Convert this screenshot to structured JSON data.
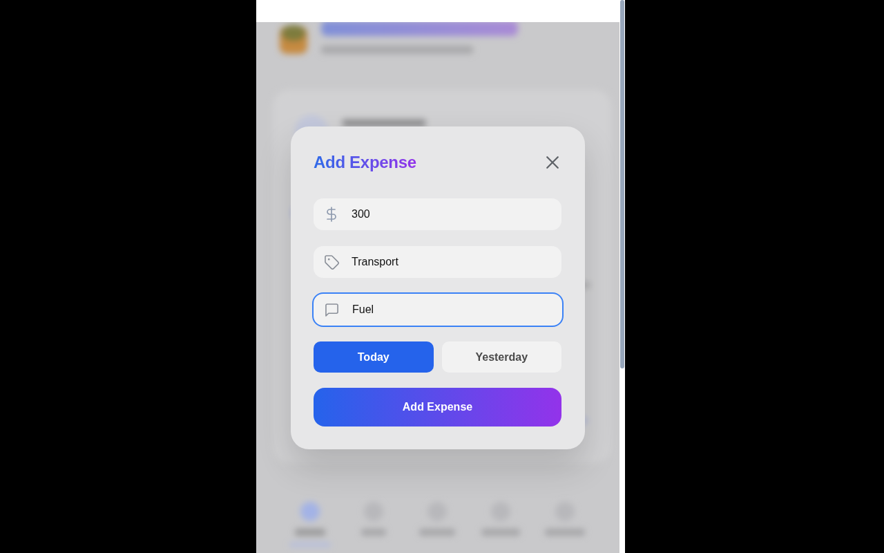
{
  "dialog": {
    "title": "Add Expense",
    "fields": [
      {
        "kind": "amount",
        "value": "300",
        "focused": false
      },
      {
        "kind": "category",
        "value": "Transport",
        "focused": false
      },
      {
        "kind": "note",
        "value": "Fuel",
        "focused": true
      }
    ],
    "date_options": [
      {
        "label": "Today",
        "selected": true
      },
      {
        "label": "Yesterday",
        "selected": false
      }
    ],
    "submit_label": "Add Expense"
  }
}
